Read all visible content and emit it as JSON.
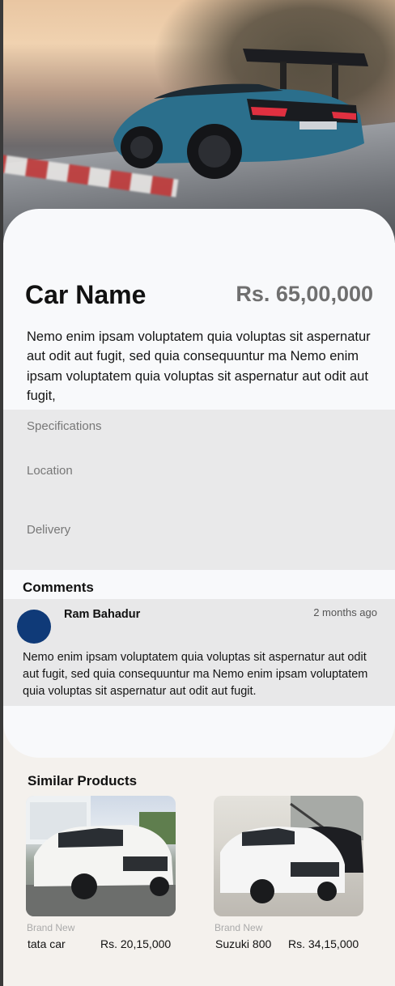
{
  "product": {
    "name": "Car Name",
    "price": "Rs. 65,00,000",
    "description": "Nemo enim ipsam voluptatem quia voluptas sit aspernatur aut odit aut fugit, sed quia consequuntur ma Nemo enim ipsam voluptatem quia voluptas sit aspernatur aut odit aut fugit,"
  },
  "specs": {
    "specifications": "Specifications",
    "location": "Location",
    "delivery": "Delivery"
  },
  "comments": {
    "title": "Comments",
    "items": [
      {
        "author": "Ram Bahadur",
        "time": "2 months ago",
        "text": "Nemo enim ipsam voluptatem quia voluptas sit aspernatur aut odit aut fugit, sed quia consequuntur ma Nemo enim ipsam voluptatem quia voluptas sit aspernatur aut odit aut fugit.",
        "avatar_color": "#0f3a78"
      }
    ]
  },
  "similar": {
    "title": "Similar Products",
    "items": [
      {
        "badge": "Brand New",
        "name": "tata car",
        "price": "Rs. 20,15,000"
      },
      {
        "badge": "Brand New",
        "name": "Suzuki 800",
        "price": "Rs. 34,15,000"
      }
    ]
  },
  "colors": {
    "page_bg": "#f4f1ed",
    "card_bg": "#f8f9fb",
    "section_bg": "#e9e9ea",
    "price_text": "#6f6f6f"
  }
}
